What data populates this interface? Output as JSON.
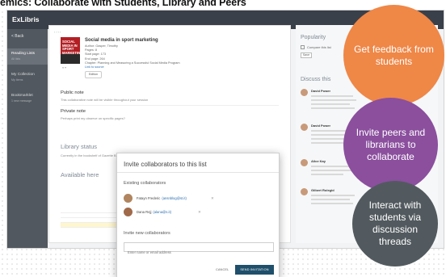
{
  "headline": "emics: Collaborate with Students, Library and Peers",
  "app": {
    "logo": "ExLibris",
    "back": "< Back",
    "sidebar": [
      {
        "label": "Reading Lists",
        "sub": "All lists"
      },
      {
        "label": "My Collection",
        "sub": "My items"
      },
      {
        "label": "Bookmarklet",
        "sub": "1 new message"
      }
    ]
  },
  "item": {
    "title": "Social media in sport marketing",
    "cover_text": "SOCIAL MEDIA IN SPORT MARKETING",
    "meta_author": "Author: Gasper, Timothy",
    "meta_pages": "Pages: 8",
    "meta_start": "Start page: 173",
    "meta_end": "End page: 264",
    "meta_chapter": "Chapter: Planning and Measuring a Successful Social Media Program",
    "meta_link": "Link to source",
    "tag": "Edition"
  },
  "notes": {
    "public_label": "Public note",
    "public_text": "This collaborative note will be visible throughout your session",
    "private_label": "Private note",
    "private_text": "Perhaps print my observe on specific pages?"
  },
  "library_status_heading": "Library status",
  "library_status_text": "Currently in the bookshelf of Gazette Books",
  "available_heading": "Available here",
  "right_panel": {
    "popularity": "Popularity",
    "check_label": "Compare this list",
    "save": "Save",
    "discuss": "Discuss this",
    "comments": [
      "David Power",
      "David Power",
      "Alice Kay",
      "Gilbert Rolegid"
    ]
  },
  "dialog": {
    "title": "Invite collaborators to this list",
    "existing_label": "Existing collaborators",
    "collaborators": [
      {
        "name": "Fatayn Frederic",
        "email": "(ansnblog@st.it)"
      },
      {
        "name": "Dana Rejj",
        "email": "(alana@s.it)"
      }
    ],
    "invite_label": "Invite new collaborators",
    "placeholder": "Enter name or email address",
    "cancel": "CANCEL",
    "send": "SEND INVITATION"
  },
  "bubbles": {
    "b1": "Get feedback from students",
    "b2": "Invite peers and librarians to collaborate",
    "b3": "Interact with students via discussion threads"
  },
  "colors": {
    "feedback": "#ef8747",
    "collaborate": "#8b4f9e",
    "discussion": "#525a5f",
    "topbar": "#3a4049",
    "primary_button": "#1f4f6b"
  }
}
